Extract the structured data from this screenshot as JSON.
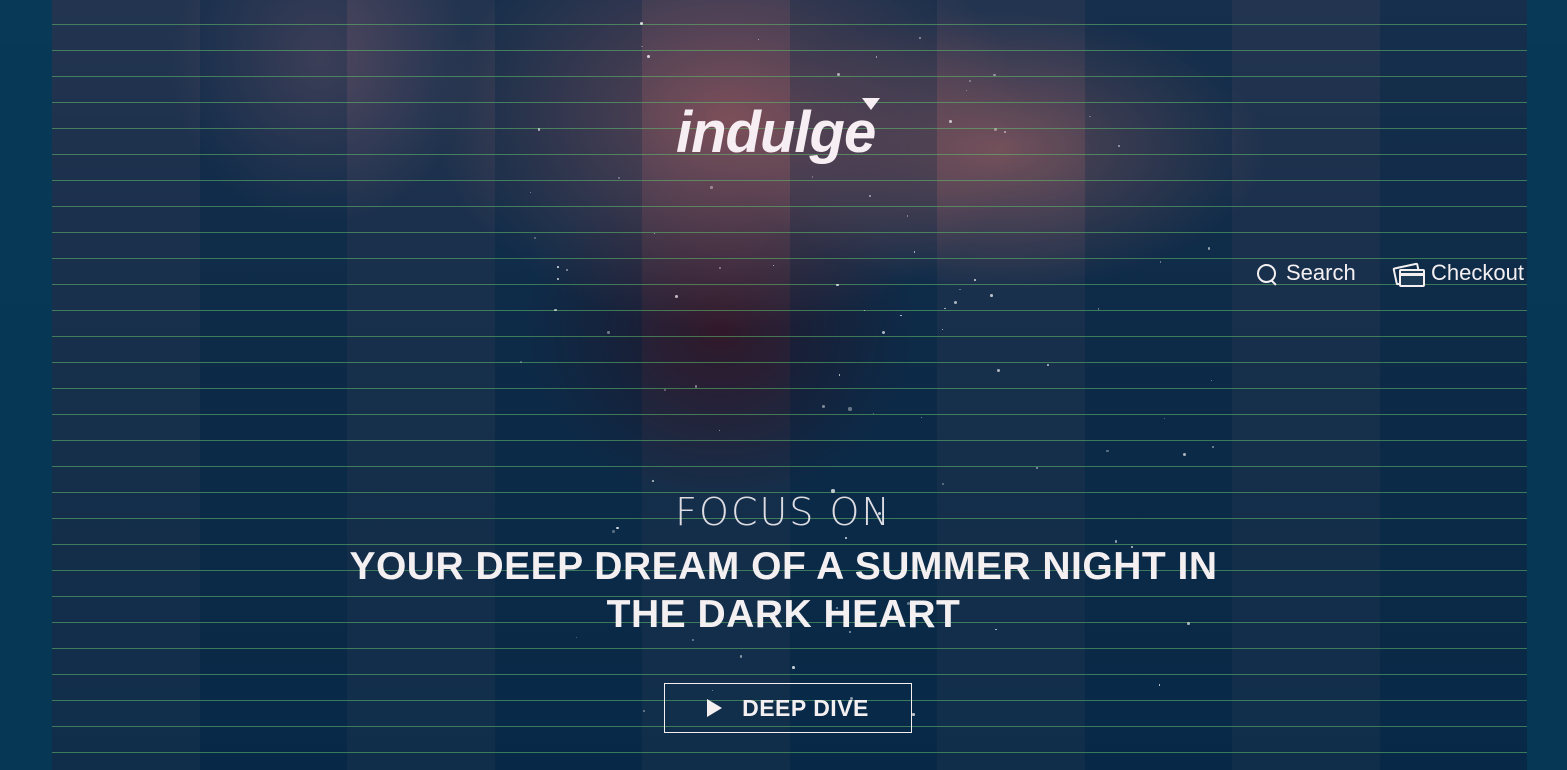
{
  "brand": {
    "logo_text": "indulge"
  },
  "nav": {
    "search_label": "Search",
    "checkout_label": "Checkout",
    "search_icon": "search-icon",
    "checkout_icon": "credit-cards-icon"
  },
  "hero": {
    "eyebrow": "FOCUS ON",
    "headline_line1": "YOUR DEEP DREAM OF A SUMMER NIGHT IN",
    "headline_line2": "THE DARK HEART",
    "cta_label": "DEEP DIVE",
    "cta_icon": "play-icon"
  },
  "colors": {
    "background": "#06344f",
    "overlay_grid": "#60be6e",
    "text": "#f4f0f2"
  }
}
